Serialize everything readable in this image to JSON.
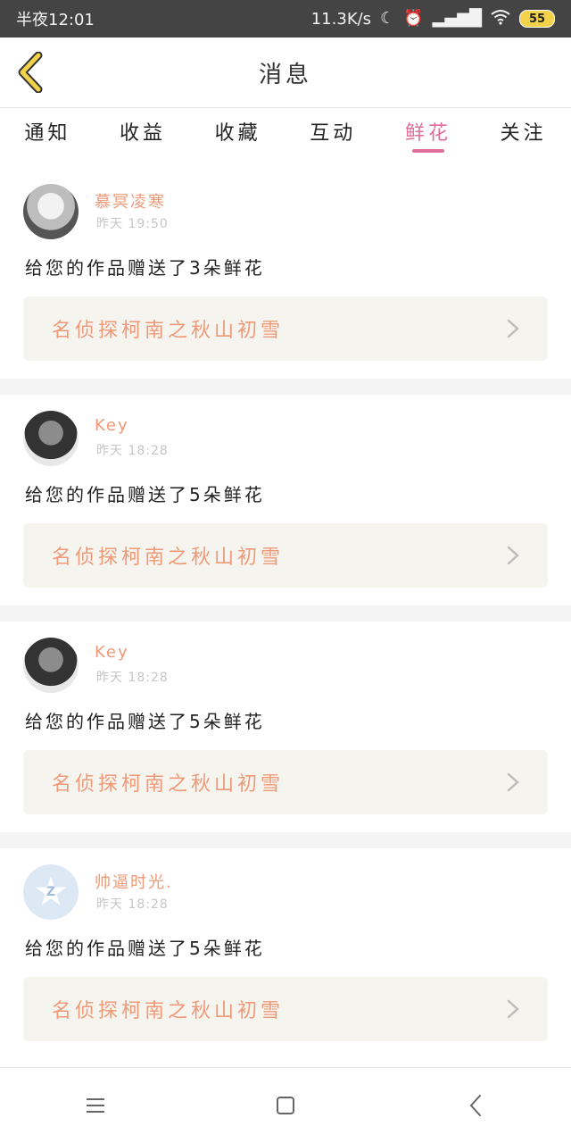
{
  "status_bar": {
    "time": "半夜12:01",
    "network_speed": "11.3K/s",
    "battery": "55"
  },
  "header": {
    "title": "消息"
  },
  "tabs": [
    {
      "label": "通知",
      "active": false
    },
    {
      "label": "收益",
      "active": false
    },
    {
      "label": "收藏",
      "active": false
    },
    {
      "label": "互动",
      "active": false
    },
    {
      "label": "鲜花",
      "active": true
    },
    {
      "label": "关注",
      "active": false
    }
  ],
  "messages": [
    {
      "username": "慕冥凌寒",
      "time": "昨天 19:50",
      "text": "给您的作品赠送了3朵鲜花",
      "work": "名侦探柯南之秋山初雪"
    },
    {
      "username": "Key",
      "time": "昨天 18:28",
      "text": "给您的作品赠送了5朵鲜花",
      "work": "名侦探柯南之秋山初雪"
    },
    {
      "username": "Key",
      "time": "昨天 18:28",
      "text": "给您的作品赠送了5朵鲜花",
      "work": "名侦探柯南之秋山初雪"
    },
    {
      "username": "帅逼时光.",
      "time": "昨天 18:28",
      "text": "给您的作品赠送了5朵鲜花",
      "work": "名侦探柯南之秋山初雪"
    }
  ],
  "colors": {
    "accent_pink": "#e06e9a",
    "username_orange": "#ee9a78",
    "back_arrow": "#f2d24a"
  }
}
